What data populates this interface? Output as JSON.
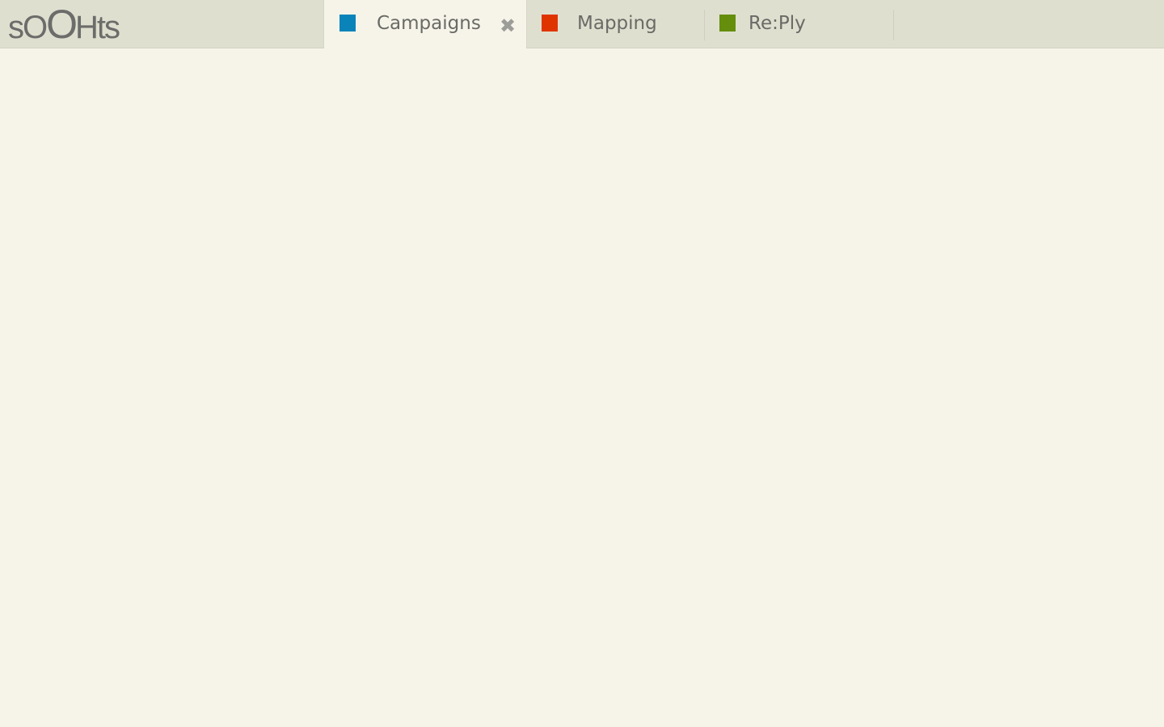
{
  "app": {
    "logo_parts": [
      "s",
      "O",
      "O",
      "Hts"
    ]
  },
  "tabs": [
    {
      "label": "Campaigns",
      "color": "#0a83b9",
      "active": true,
      "close_icon": "close-icon"
    },
    {
      "label": "Mapping",
      "color": "#e03400",
      "active": false
    },
    {
      "label": "Re:Ply",
      "color": "#648e0c",
      "active": false
    }
  ]
}
